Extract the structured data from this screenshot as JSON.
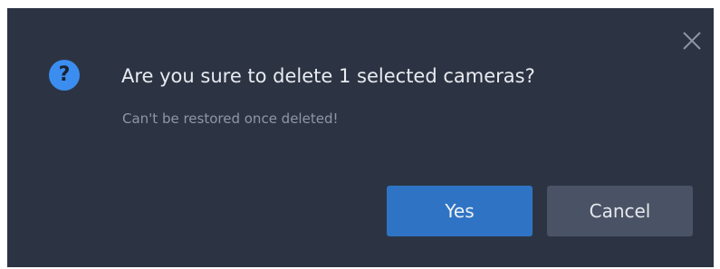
{
  "dialog": {
    "title": "Are you sure to delete 1 selected cameras?",
    "subtitle": "Can't be restored once deleted!",
    "icon": "question-icon",
    "close_icon": "close-icon",
    "yes_label": "Yes",
    "cancel_label": "Cancel",
    "colors": {
      "background": "#2c3443",
      "accent": "#3b8ef0",
      "primary_button": "#2f74c4",
      "secondary_button": "#4a5365"
    }
  }
}
